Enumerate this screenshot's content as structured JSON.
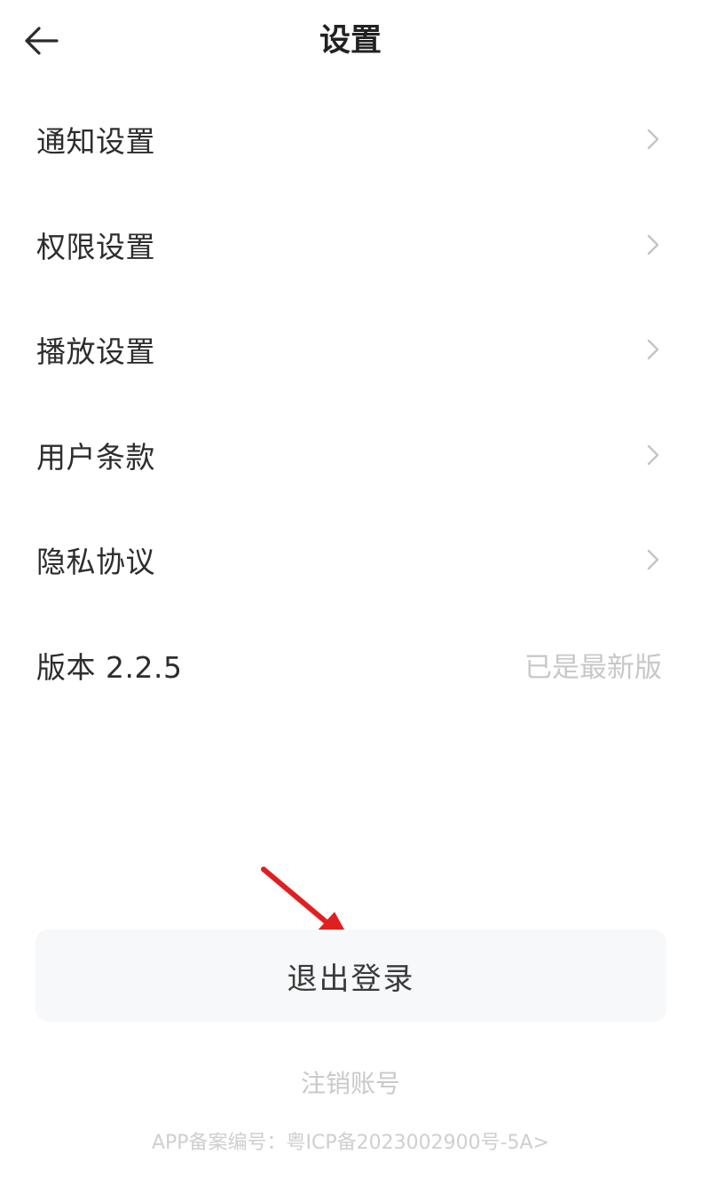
{
  "header": {
    "title": "设置",
    "back_icon": "arrow-left-icon"
  },
  "menu": {
    "items": [
      {
        "label": "通知设置",
        "icon": "chevron-right-icon"
      },
      {
        "label": "权限设置",
        "icon": "chevron-right-icon"
      },
      {
        "label": "播放设置",
        "icon": "chevron-right-icon"
      },
      {
        "label": "用户条款",
        "icon": "chevron-right-icon"
      },
      {
        "label": "隐私协议",
        "icon": "chevron-right-icon"
      }
    ],
    "version": {
      "label": "版本 2.2.5",
      "status": "已是最新版"
    }
  },
  "actions": {
    "logout_label": "退出登录",
    "cancel_account_label": "注销账号",
    "icp_text": "APP备案编号：粤ICP备2023002900号-5A>"
  },
  "annotation": {
    "arrow_color": "#e02020"
  },
  "colors": {
    "background": "#ffffff",
    "logout_bg": "#f7f8fa",
    "muted_text": "#c9c9c9"
  }
}
